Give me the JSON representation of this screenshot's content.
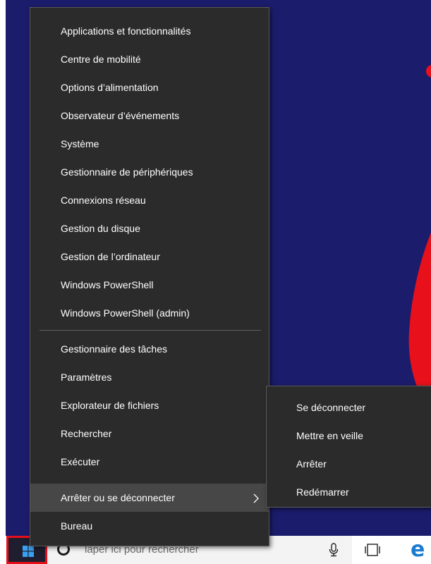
{
  "menu": {
    "items": [
      {
        "label": "Applications et fonctionnalités"
      },
      {
        "label": "Centre de mobilité"
      },
      {
        "label": "Options d’alimentation"
      },
      {
        "label": "Observateur d’événements"
      },
      {
        "label": "Système"
      },
      {
        "label": "Gestionnaire de périphériques"
      },
      {
        "label": "Connexions réseau"
      },
      {
        "label": "Gestion du disque"
      },
      {
        "label": "Gestion de l’ordinateur"
      },
      {
        "label": "Windows PowerShell"
      },
      {
        "label": "Windows PowerShell (admin)"
      },
      {
        "label": "Gestionnaire des tâches"
      },
      {
        "label": "Paramètres"
      },
      {
        "label": "Explorateur de fichiers"
      },
      {
        "label": "Rechercher"
      },
      {
        "label": "Exécuter"
      },
      {
        "label": "Arrêter ou se déconnecter"
      },
      {
        "label": "Bureau"
      }
    ]
  },
  "submenu": {
    "items": [
      {
        "label": "Se déconnecter"
      },
      {
        "label": "Mettre en veille"
      },
      {
        "label": "Arrêter"
      },
      {
        "label": "Redémarrer"
      }
    ]
  },
  "taskbar": {
    "search_placeholder": "laper ici pour rechercher"
  },
  "colors": {
    "desktop": "#1c1c6c",
    "desktop_shape": "#e8101a",
    "menu_bg": "#2b2b2b",
    "menu_hover": "#474747",
    "start_highlight": "#e5101a",
    "edge_blue": "#1a7bd0"
  },
  "icons": {
    "start": "windows-logo-icon",
    "cortana": "cortana-ring-icon",
    "mic": "microphone-icon",
    "task_view": "task-view-icon",
    "edge": "edge-browser-icon",
    "submenu_arrow": "chevron-right-icon"
  }
}
